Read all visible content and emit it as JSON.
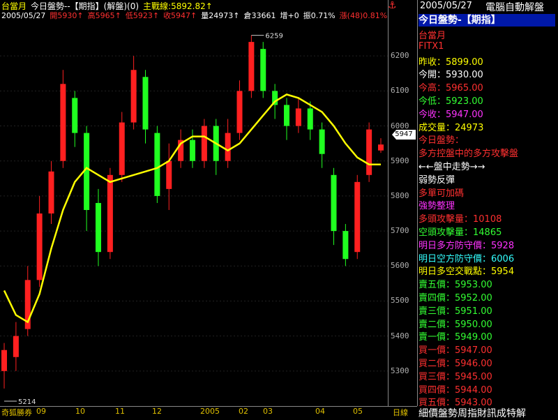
{
  "header": {
    "line1": [
      {
        "text": "台當月",
        "color": "#ffff00"
      },
      {
        "text": "今日盤勢--【期指】(解盤)(0)",
        "color": "#ffffff"
      },
      {
        "text": "主戰線:5892.82↑",
        "color": "#ffff00"
      }
    ],
    "line2": [
      {
        "text": "2005/05/27",
        "color": "#ffffff"
      },
      {
        "text": "開5930↑",
        "color": "#ff3030"
      },
      {
        "text": "高5965↑",
        "color": "#ff3030"
      },
      {
        "text": "低5923↑",
        "color": "#ff3030"
      },
      {
        "text": "收5947↑",
        "color": "#ff3030"
      },
      {
        "text": "量24973↑",
        "color": "#ffffff"
      },
      {
        "text": "倉33661",
        "color": "#ffffff"
      },
      {
        "text": "增+0",
        "color": "#ffffff"
      },
      {
        "text": "振0.71%",
        "color": "#ffffff"
      },
      {
        "text": "漲(48)0.81%",
        "color": "#ff3030"
      }
    ]
  },
  "price_axis": {
    "ticks": [
      "6200",
      "6100",
      "6000",
      "5900",
      "5800",
      "5700",
      "5600",
      "5500",
      "5400",
      "5300"
    ],
    "current_flag": "5947",
    "anchor_icon": "⚓"
  },
  "annotations": {
    "high": "6259",
    "low": "5214"
  },
  "bottom": {
    "source": "奇狐勝券",
    "months": [
      "09",
      "10",
      "11",
      "12",
      "2005",
      "02",
      "03",
      "04",
      "05"
    ],
    "period": "日線"
  },
  "right_panel": {
    "title_date": "2005/05/27",
    "title_name": "電腦自動解盤",
    "section": "今日盤勢-【期指】",
    "lines": [
      {
        "text": "台當月",
        "color": "#ff3030"
      },
      {
        "text": "FITX1",
        "color": "#ff3030"
      },
      {
        "text": "昨收：5899.00",
        "color": "#ffff00"
      },
      {
        "text": "今開：5930.00",
        "color": "#ffffff"
      },
      {
        "text": "今高：5965.00",
        "color": "#ff3030"
      },
      {
        "text": "今低：5923.00",
        "color": "#33ff33"
      },
      {
        "text": "今收：5947.00",
        "color": "#ff33ff"
      },
      {
        "text": "成交量：24973",
        "color": "#ffff00"
      },
      {
        "text": "今日盤勢：",
        "color": "#ff3030"
      },
      {
        "text": "多方控盤中的多方攻擊盤",
        "color": "#ff3030"
      },
      {
        "text": "←←盤中走勢→→",
        "color": "#ffffff"
      },
      {
        "text": "弱勢反彈",
        "color": "#ffffff"
      },
      {
        "text": "多單可加碼",
        "color": "#ff3030"
      },
      {
        "text": "強勢整理",
        "color": "#ff33ff"
      },
      {
        "text": "多頭攻擊量：10108",
        "color": "#ff3030"
      },
      {
        "text": "空頭攻擊量：14865",
        "color": "#33ff33"
      },
      {
        "text": "明日多方防守價：5928",
        "color": "#ff33ff"
      },
      {
        "text": "明日空方防守價：6006",
        "color": "#33ffff"
      },
      {
        "text": "明日多空交戰點：5954",
        "color": "#ffff00"
      },
      {
        "text": "賣五價：5953.00",
        "color": "#33ff33"
      },
      {
        "text": "賣四價：5952.00",
        "color": "#33ff33"
      },
      {
        "text": "賣三價：5951.00",
        "color": "#33ff33"
      },
      {
        "text": "賣二價：5950.00",
        "color": "#33ff33"
      },
      {
        "text": "賣一價：5949.00",
        "color": "#33ff33"
      },
      {
        "text": "買一價：5947.00",
        "color": "#ff3030"
      },
      {
        "text": "買二價：5946.00",
        "color": "#ff3030"
      },
      {
        "text": "買三價：5945.00",
        "color": "#ff3030"
      },
      {
        "text": "買四價：5944.00",
        "color": "#ff3030"
      },
      {
        "text": "買五價：5943.00",
        "color": "#ff3030"
      }
    ],
    "ticker": "細價盤勢周指財訊成特解"
  },
  "chart_data": {
    "type": "candlestick",
    "title": "",
    "ylim": [
      5200,
      6300
    ],
    "x_month_labels": [
      "09",
      "10",
      "11",
      "12",
      "2005",
      "02",
      "03",
      "04",
      "05"
    ],
    "high_label": 6259,
    "low_label": 5214,
    "moving_average_line": {
      "color": "#ffff00",
      "points": [
        [
          0,
          5530
        ],
        [
          1,
          5460
        ],
        [
          2,
          5440
        ],
        [
          3,
          5520
        ],
        [
          4,
          5650
        ],
        [
          5,
          5760
        ],
        [
          6,
          5840
        ],
        [
          7,
          5880
        ],
        [
          8,
          5860
        ],
        [
          9,
          5840
        ],
        [
          10,
          5850
        ],
        [
          11,
          5860
        ],
        [
          12,
          5870
        ],
        [
          13,
          5880
        ],
        [
          14,
          5900
        ],
        [
          15,
          5950
        ],
        [
          16,
          5970
        ],
        [
          17,
          5970
        ],
        [
          18,
          5950
        ],
        [
          19,
          5930
        ],
        [
          20,
          5950
        ],
        [
          21,
          5990
        ],
        [
          22,
          6030
        ],
        [
          23,
          6070
        ],
        [
          24,
          6090
        ],
        [
          25,
          6080
        ],
        [
          26,
          6060
        ],
        [
          27,
          6040
        ],
        [
          28,
          6000
        ],
        [
          29,
          5950
        ],
        [
          30,
          5910
        ],
        [
          31,
          5890
        ],
        [
          32,
          5890
        ]
      ]
    },
    "candles_summary": [
      {
        "x": 0,
        "o": 5300,
        "c": 5360,
        "h": 5380,
        "l": 5250
      },
      {
        "x": 1,
        "o": 5340,
        "c": 5400,
        "h": 5440,
        "l": 5300
      },
      {
        "x": 2,
        "o": 5420,
        "c": 5560,
        "h": 5600,
        "l": 5400
      },
      {
        "x": 3,
        "o": 5560,
        "c": 5750,
        "h": 5800,
        "l": 5540
      },
      {
        "x": 4,
        "o": 5750,
        "c": 5870,
        "h": 5900,
        "l": 5720
      },
      {
        "x": 5,
        "o": 5900,
        "c": 6120,
        "h": 6160,
        "l": 5880
      },
      {
        "x": 6,
        "o": 6080,
        "c": 5980,
        "h": 6100,
        "l": 5940
      },
      {
        "x": 7,
        "o": 5980,
        "c": 5760,
        "h": 6000,
        "l": 5700
      },
      {
        "x": 8,
        "o": 5780,
        "c": 5640,
        "h": 5820,
        "l": 5600
      },
      {
        "x": 9,
        "o": 5640,
        "c": 5860,
        "h": 5880,
        "l": 5620
      },
      {
        "x": 10,
        "o": 5860,
        "c": 6010,
        "h": 6040,
        "l": 5840
      },
      {
        "x": 11,
        "o": 6010,
        "c": 6160,
        "h": 6200,
        "l": 5990
      },
      {
        "x": 12,
        "o": 6140,
        "c": 5990,
        "h": 6160,
        "l": 5950
      },
      {
        "x": 13,
        "o": 5980,
        "c": 5800,
        "h": 6000,
        "l": 5780
      },
      {
        "x": 14,
        "o": 5820,
        "c": 5900,
        "h": 5950,
        "l": 5760
      },
      {
        "x": 15,
        "o": 5900,
        "c": 5960,
        "h": 5990,
        "l": 5880
      },
      {
        "x": 16,
        "o": 5960,
        "c": 5900,
        "h": 5990,
        "l": 5880
      },
      {
        "x": 17,
        "o": 5900,
        "c": 6000,
        "h": 6020,
        "l": 5880
      },
      {
        "x": 18,
        "o": 6000,
        "c": 5900,
        "h": 6020,
        "l": 5860
      },
      {
        "x": 19,
        "o": 5900,
        "c": 5980,
        "h": 6020,
        "l": 5880
      },
      {
        "x": 20,
        "o": 5980,
        "c": 6100,
        "h": 6130,
        "l": 5960
      },
      {
        "x": 21,
        "o": 6100,
        "c": 6240,
        "h": 6259,
        "l": 6080
      },
      {
        "x": 22,
        "o": 6220,
        "c": 6100,
        "h": 6240,
        "l": 6080
      },
      {
        "x": 23,
        "o": 6100,
        "c": 6060,
        "h": 6120,
        "l": 6020
      },
      {
        "x": 24,
        "o": 6060,
        "c": 6000,
        "h": 6080,
        "l": 5960
      },
      {
        "x": 25,
        "o": 6000,
        "c": 6050,
        "h": 6080,
        "l": 5980
      },
      {
        "x": 26,
        "o": 6050,
        "c": 5990,
        "h": 6070,
        "l": 5960
      },
      {
        "x": 27,
        "o": 5990,
        "c": 5920,
        "h": 6010,
        "l": 5880
      },
      {
        "x": 28,
        "o": 5860,
        "c": 5700,
        "h": 5880,
        "l": 5660
      },
      {
        "x": 29,
        "o": 5700,
        "c": 5620,
        "h": 5720,
        "l": 5600
      },
      {
        "x": 30,
        "o": 5640,
        "c": 5840,
        "h": 5860,
        "l": 5620
      },
      {
        "x": 31,
        "o": 5860,
        "c": 5990,
        "h": 6010,
        "l": 5840
      },
      {
        "x": 32,
        "o": 5930,
        "c": 5947,
        "h": 5965,
        "l": 5923
      }
    ]
  }
}
